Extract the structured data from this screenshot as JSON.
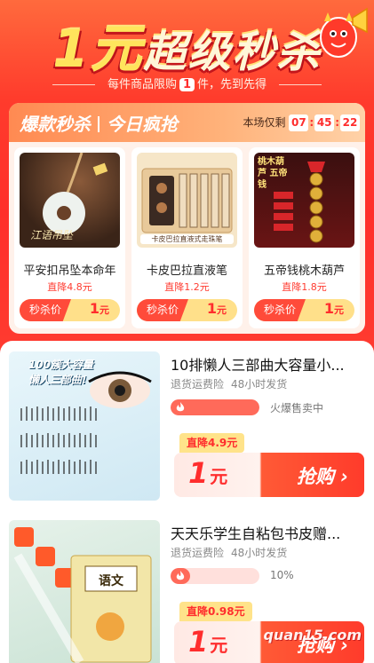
{
  "hero": {
    "title_one": "1元",
    "title_rest": "超级秒杀",
    "subtitle_pre": "每件商品限购",
    "subtitle_num": "1",
    "subtitle_post": "件，先到先得"
  },
  "flash": {
    "title_left": "爆款秒杀",
    "title_right": "今日疯抢",
    "timer_label": "本场仅剩",
    "timer": {
      "h": "07",
      "m": "45",
      "s": "22"
    },
    "colon": ":",
    "items": [
      {
        "name": "平安扣吊坠本命年",
        "drop": "直降4.8元",
        "price_label": "秒杀价",
        "price": "1",
        "unit": "元",
        "thumb_caption": "江语吊坠"
      },
      {
        "name": "卡皮巴拉直液笔",
        "drop": "直降1.2元",
        "price_label": "秒杀价",
        "price": "1",
        "unit": "元",
        "thumb_caption": "卡皮巴拉直液式走珠笔"
      },
      {
        "name": "五帝钱桃木葫芦",
        "drop": "直降1.8元",
        "price_label": "秒杀价",
        "price": "1",
        "unit": "元",
        "thumb_caption": "桃木葫芦 五帝钱"
      }
    ]
  },
  "products": [
    {
      "title": "10排懒人三部曲大容量小...",
      "tags": [
        "退货运费险",
        "48小时发货"
      ],
      "hot_text": "火爆售卖中",
      "progress": 1.0,
      "drop": "直降4.9元",
      "price": "1",
      "unit": "元",
      "buy_label": "抢购 ›",
      "img_caption": "100簇大容量 懒人三部曲!"
    },
    {
      "title": "天天乐学生自粘包书皮赠...",
      "tags": [
        "退货运费险",
        "48小时发货"
      ],
      "hot_text": "10%",
      "progress": 0.1,
      "drop": "直降0.98元",
      "price": "1",
      "unit": "元",
      "buy_label": "抢购 ›",
      "img_caption": "语文"
    }
  ],
  "watermark": "quan15.com",
  "colors": {
    "brand_red": "#ff2d2d",
    "accent_yellow": "#ffe38a"
  }
}
